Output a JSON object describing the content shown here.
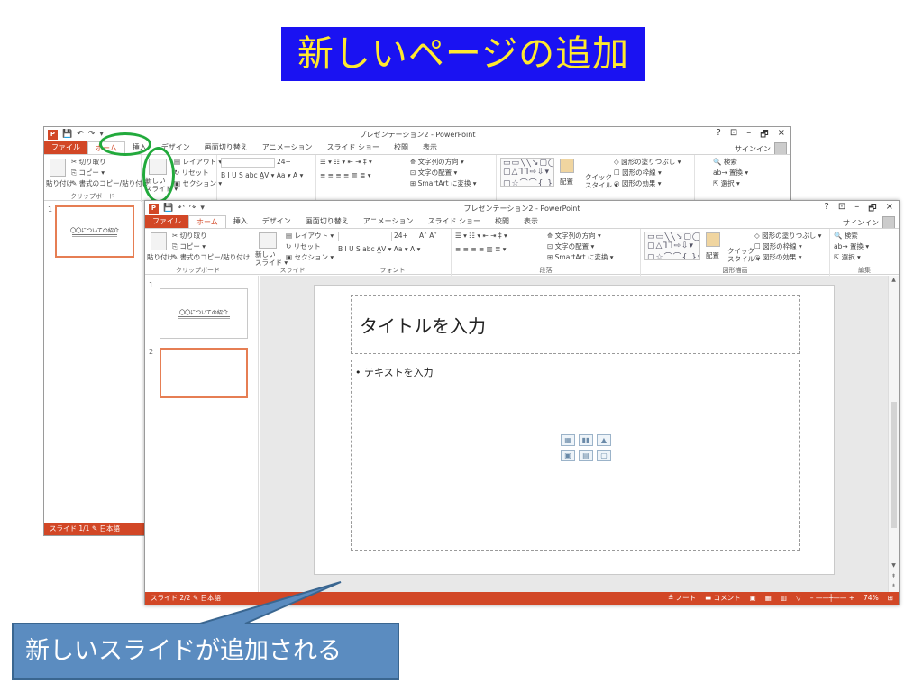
{
  "banner": {
    "title": "新しいページの追加"
  },
  "app": {
    "window_title": "プレゼンテーション2 - PowerPoint",
    "window_controls": [
      "?",
      "⊡",
      "–",
      "🗗",
      "×"
    ],
    "qat": [
      "💾",
      "↶",
      "↷",
      "▾"
    ],
    "signin": "サインイン"
  },
  "ribbon_tabs": [
    "ファイル",
    "ホーム",
    "挿入",
    "デザイン",
    "画面切り替え",
    "アニメーション",
    "スライド ショー",
    "校閲",
    "表示"
  ],
  "ribbon": {
    "paste": "貼り付け",
    "cut": "✂ 切り取り",
    "copy": "⎘ コピー ▾",
    "format_painter": "✎ 書式のコピー/貼り付け",
    "clipboard_group": "クリップボード",
    "new_slide": "新しい\nスライド ▾",
    "layout": "▤ レイアウト ▾",
    "reset": "↻ リセット",
    "section": "▣ セクション ▾",
    "slides_group": "スライド",
    "font_size": "24+",
    "font_grow": "A˄ A˅",
    "font_buttons": "B I U S abc A̲V ▾ Aa ▾  A ▾",
    "font_group": "フォント",
    "para_buttons": "☰ ▾ ☷ ▾  ⇤ ⇥  ‡ ▾",
    "para_row2": "≡ ≡ ≡ ≡ ▥  ≣ ▾",
    "text_direction": "⟰ 文字列の方向 ▾",
    "align_text": "⊡ 文字の配置 ▾",
    "smartart": "⊞ SmartArt に変換 ▾",
    "paragraph_group": "段落",
    "shapes_row1": "▭▭╲╲↘▢◯▾",
    "shapes_row2": "▢△⅂⅂⇨⇩▾",
    "shapes_row3": "▢☆⌒⌒{ }▾",
    "arrange": "配置",
    "quick_style": "クイック\nスタイル ▾",
    "shape_fill": "◇ 図形の塗りつぶし ▾",
    "shape_outline": "☐ 図形の枠線 ▾",
    "shape_effects": "◎ 図形の効果 ▾",
    "drawing_group": "図形描画",
    "find": "🔍 検索",
    "replace": "ab→ 置換 ▾",
    "select": "⇱ 選択 ▾",
    "editing_group": "編集"
  },
  "back_window": {
    "slides": [
      {
        "num": "1",
        "title": "〇〇についての紹介"
      }
    ],
    "status": "スライド 1/1   ✎  日本語"
  },
  "front_window": {
    "slides": [
      {
        "num": "1",
        "title": "〇〇についての紹介"
      },
      {
        "num": "2",
        "title": ""
      }
    ],
    "title_placeholder": "タイトルを入力",
    "body_placeholder": "• テキストを入力",
    "content_icons": [
      "▦",
      "▮▮",
      "▲",
      "▣",
      "▤",
      "▢"
    ],
    "status_left": "スライド 2/2   ✎  日本語",
    "status_right": [
      "≜ ノート",
      "▬ コメント",
      "▣",
      "▦",
      "▥",
      "▽",
      "– ——┼—— +",
      "74%",
      "⊞"
    ],
    "scroll_arrows": [
      "▲",
      "▼",
      "⇞",
      "⇟"
    ]
  },
  "callout": {
    "text": "新しいスライドが追加される",
    "fill": "#5b8cc0",
    "border": "#3a6690"
  },
  "colors": {
    "banner_bg": "#1a12f2",
    "banner_text": "#ffe92e",
    "accent": "#d24726",
    "selection": "#e67e53",
    "circle": "#22aa3c"
  }
}
